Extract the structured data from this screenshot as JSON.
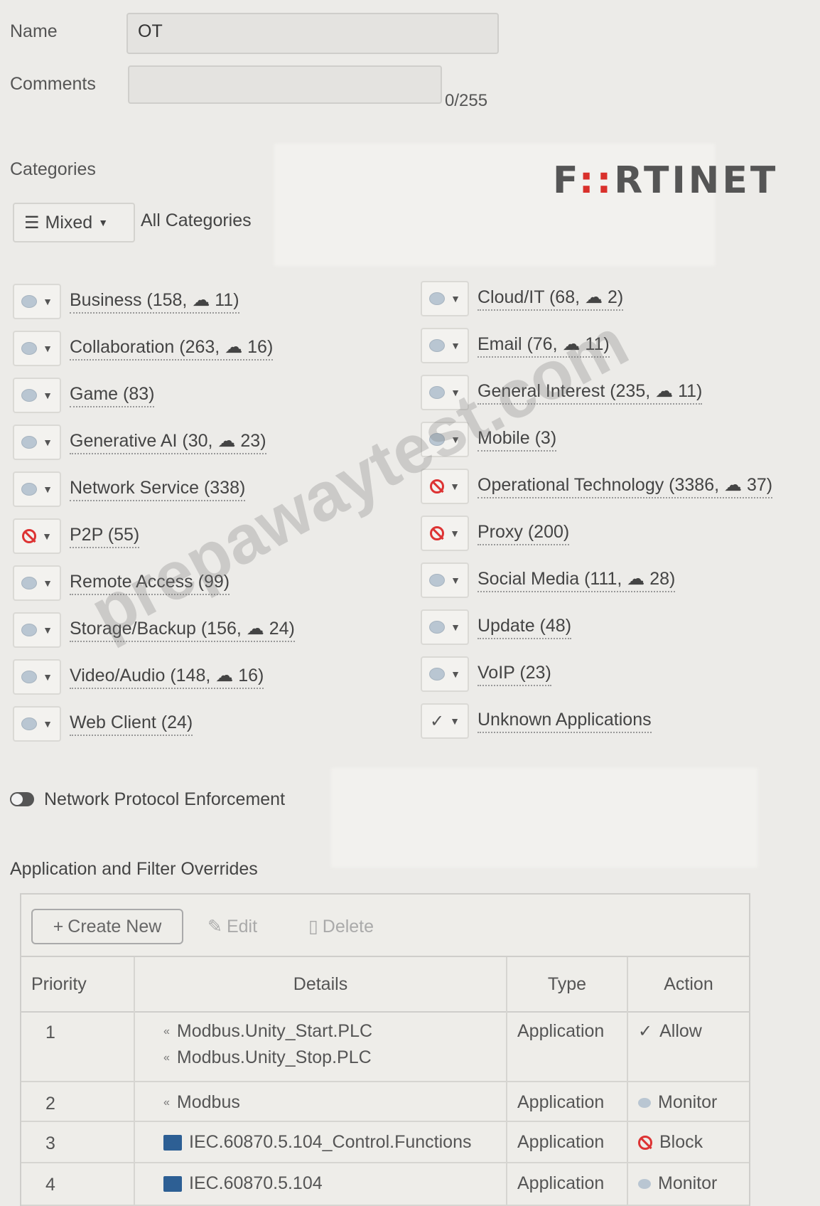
{
  "form": {
    "name_label": "Name",
    "name_value": "OT",
    "comments_label": "Comments",
    "comments_value": "",
    "comments_counter": "0/255"
  },
  "brand": {
    "logo_pre": "F",
    "logo_mid": "::",
    "logo_post": "RTINET"
  },
  "categories": {
    "section_label": "Categories",
    "mixed_label": "Mixed",
    "all_label": "All Categories",
    "left": [
      {
        "label": "Business (158, ☁ 11)",
        "action": "monitor"
      },
      {
        "label": "Collaboration (263, ☁ 16)",
        "action": "monitor"
      },
      {
        "label": "Game (83)",
        "action": "monitor"
      },
      {
        "label": "Generative AI (30, ☁ 23)",
        "action": "monitor"
      },
      {
        "label": "Network Service (338)",
        "action": "monitor"
      },
      {
        "label": "P2P (55)",
        "action": "block"
      },
      {
        "label": "Remote Access (99)",
        "action": "monitor"
      },
      {
        "label": "Storage/Backup (156, ☁ 24)",
        "action": "monitor"
      },
      {
        "label": "Video/Audio (148, ☁ 16)",
        "action": "monitor"
      },
      {
        "label": "Web Client (24)",
        "action": "monitor"
      }
    ],
    "right": [
      {
        "label": "Cloud/IT (68, ☁ 2)",
        "action": "monitor"
      },
      {
        "label": "Email (76, ☁ 11)",
        "action": "monitor"
      },
      {
        "label": "General Interest (235, ☁ 11)",
        "action": "monitor"
      },
      {
        "label": "Mobile (3)",
        "action": "monitor"
      },
      {
        "label": "Operational Technology (3386, ☁ 37)",
        "action": "block"
      },
      {
        "label": "Proxy (200)",
        "action": "block"
      },
      {
        "label": "Social Media (111, ☁ 28)",
        "action": "monitor"
      },
      {
        "label": "Update (48)",
        "action": "monitor"
      },
      {
        "label": "VoIP (23)",
        "action": "monitor"
      },
      {
        "label": "Unknown Applications",
        "action": "allow"
      }
    ]
  },
  "network_protocol": {
    "label": "Network Protocol Enforcement"
  },
  "overrides": {
    "section_label": "Application and Filter Overrides",
    "create_label": "Create New",
    "edit_label": "Edit",
    "delete_label": "Delete",
    "columns": [
      "Priority",
      "Details",
      "Type",
      "Action"
    ],
    "rows": [
      {
        "priority": "1",
        "details": [
          "Modbus.Unity_Start.PLC",
          "Modbus.Unity_Stop.PLC"
        ],
        "type": "Application",
        "action": "Allow"
      },
      {
        "priority": "2",
        "details": [
          "Modbus"
        ],
        "type": "Application",
        "action": "Monitor"
      },
      {
        "priority": "3",
        "details": [
          "IEC.60870.5.104_Control.Functions"
        ],
        "type": "Application",
        "action": "Block"
      },
      {
        "priority": "4",
        "details": [
          "IEC.60870.5.104"
        ],
        "type": "Application",
        "action": "Monitor"
      }
    ]
  },
  "watermark": "prepawaytest.com"
}
